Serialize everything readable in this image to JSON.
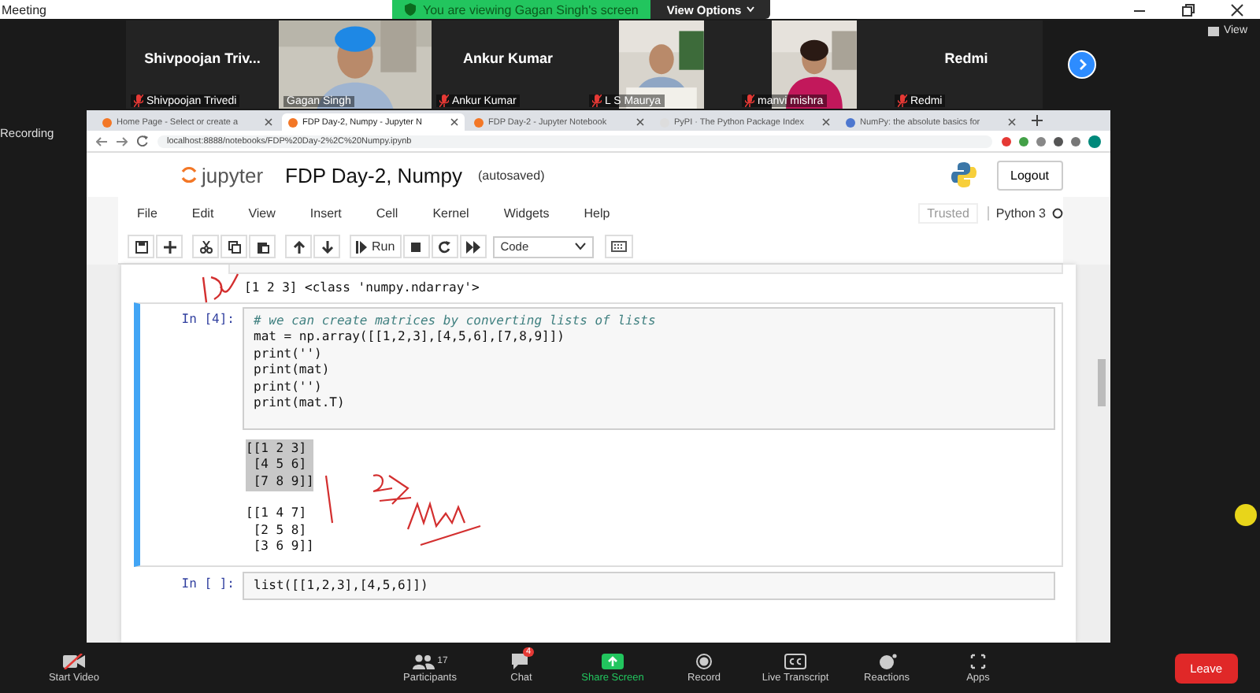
{
  "meeting_title": "Meeting",
  "banner": {
    "text": "You are viewing Gagan Singh's screen",
    "view_options": "View Options"
  },
  "gallery": [
    {
      "kind": "name",
      "display": "Shivpoojan  Triv...",
      "label": "Shivpoojan Trivedi",
      "muted": true
    },
    {
      "kind": "video",
      "label": "Gagan Singh",
      "muted": false
    },
    {
      "kind": "name",
      "display": "Ankur Kumar",
      "label": "Ankur Kumar",
      "muted": true
    },
    {
      "kind": "video",
      "label": "L S Maurya",
      "muted": true
    },
    {
      "kind": "video",
      "label": "manvi mishra",
      "muted": true
    },
    {
      "kind": "name",
      "display": "Redmi",
      "label": "Redmi",
      "muted": true
    }
  ],
  "view_button": "View",
  "recording": "Recording",
  "browser": {
    "tabs": [
      {
        "title": "Home Page - Select or create a",
        "selected": false
      },
      {
        "title": "FDP Day-2, Numpy - Jupyter N",
        "selected": true
      },
      {
        "title": "FDP Day-2 - Jupyter Notebook",
        "selected": false
      },
      {
        "title": "PyPI · The Python Package Index",
        "selected": false
      },
      {
        "title": "NumPy: the absolute basics for",
        "selected": false
      }
    ],
    "url": "localhost:8888/notebooks/FDP%20Day-2%2C%20Numpy.ipynb"
  },
  "jupyter": {
    "logo": "jupyter",
    "title": "FDP Day-2, Numpy",
    "status": "(autosaved)",
    "logout": "Logout",
    "menu": [
      "File",
      "Edit",
      "View",
      "Insert",
      "Cell",
      "Kernel",
      "Widgets",
      "Help"
    ],
    "trusted": "Trusted",
    "kernel": "Python 3",
    "run": "Run",
    "cell_type": "Code"
  },
  "cells": [
    {
      "kind": "output",
      "lines": [
        "[1 2 3] <class 'numpy.ndarray'>"
      ]
    },
    {
      "kind": "code",
      "selected": true,
      "prompt": "In [4]:",
      "lines": [
        {
          "kind": "comment",
          "text": "# we can create matrices by converting lists of lists"
        },
        {
          "kind": "code",
          "text": "mat = np.array([[1,2,3],[4,5,6],[7,8,9]])"
        },
        {
          "kind": "code",
          "text": "print('')"
        },
        {
          "kind": "code",
          "text": "print(mat)"
        },
        {
          "kind": "code",
          "text": "print('')"
        },
        {
          "kind": "code",
          "text": "print(mat.T)"
        }
      ],
      "outputs": [
        {
          "lines": [
            "[[1 2 3]",
            " [4 5 6]",
            " [7 8 9]]"
          ],
          "highlighted": true
        },
        {
          "lines": [
            "[[1 4 7]",
            " [2 5 8]",
            " [3 6 9]]"
          ],
          "highlighted": false
        }
      ]
    },
    {
      "kind": "code",
      "selected": false,
      "prompt": "In [ ]:",
      "lines": [
        {
          "kind": "code",
          "text": "list([[1,2,3],[4,5,6]])"
        }
      ]
    }
  ],
  "toolbar": [
    {
      "kind": "video",
      "label": "Start Video"
    },
    {
      "kind": "participants",
      "label": "Participants",
      "count": "17"
    },
    {
      "kind": "chat",
      "label": "Chat",
      "badge": "4"
    },
    {
      "kind": "share",
      "label": "Share Screen"
    },
    {
      "kind": "record",
      "label": "Record"
    },
    {
      "kind": "cc",
      "label": "Live Transcript"
    },
    {
      "kind": "reactions",
      "label": "Reactions"
    },
    {
      "kind": "apps",
      "label": "Apps"
    }
  ],
  "leave": "Leave"
}
